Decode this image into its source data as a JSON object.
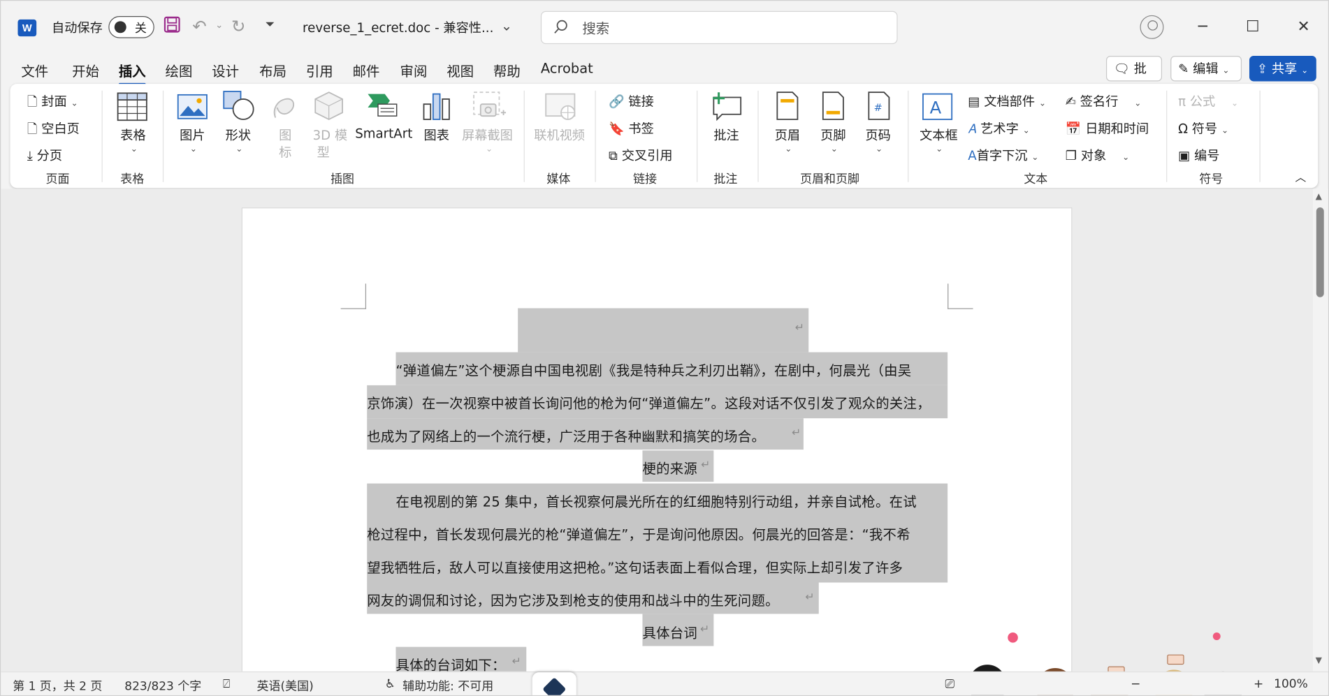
{
  "titlebar": {
    "autosave_label": "自动保存",
    "toggle_state": "关",
    "document_title": "reverse_1_ecret.doc  -  兼容性...",
    "search_placeholder": "搜索",
    "icons": [
      "word-logo",
      "save-icon",
      "undo-icon",
      "redo-icon",
      "customize-qat-icon",
      "search-icon",
      "avatar-icon",
      "minimize-icon",
      "maximize-icon",
      "close-icon"
    ]
  },
  "menu": {
    "tabs": [
      "文件",
      "开始",
      "插入",
      "绘图",
      "设计",
      "布局",
      "引用",
      "邮件",
      "审阅",
      "视图",
      "帮助",
      "Acrobat"
    ],
    "active_tab": "插入",
    "comment_button": "批注",
    "edit_button": "编辑",
    "share_button": "共享"
  },
  "ribbon": {
    "pages": {
      "items": [
        "封面",
        "空白页",
        "分页"
      ],
      "label": "页面"
    },
    "tables": {
      "item": "表格",
      "label": "表格"
    },
    "illustrations": {
      "picture": "图片",
      "shapes": "形状",
      "icons_line1": "图",
      "icons_line2": "标",
      "model_line1": "3D 模",
      "model_line2": "型",
      "smartart": "SmartArt",
      "chart": "图表",
      "screenshot": "屏幕截图",
      "label": "插图"
    },
    "media": {
      "item": "联机视频",
      "label": "媒体"
    },
    "links": {
      "items": [
        "链接",
        "书签",
        "交叉引用"
      ],
      "label": "链接"
    },
    "comments": {
      "item": "批注",
      "label": "批注"
    },
    "header_footer": {
      "items": [
        "页眉",
        "页脚",
        "页码"
      ],
      "label": "页眉和页脚"
    },
    "text": {
      "textbox": "文本框",
      "quick_parts": "文档部件",
      "wordart": "艺术字",
      "dropcap": "首字下沉",
      "signature": "签名行",
      "datetime": "日期和时间",
      "object": "对象",
      "label": "文本"
    },
    "symbols": {
      "equation": "公式",
      "symbol": "符号",
      "number": "编号",
      "label": "符号"
    }
  },
  "document": {
    "paragraph_mark": "↵",
    "lines": [
      "“弹道偏左”这个梗源自中国电视剧《我是特种兵之利刃出鞘》，在剧中，何晨光（由吴",
      "京饰演）在一次视察中被首长询问他的枪为何“弹道偏左”。这段对话不仅引发了观众的关注，",
      "也成为了网络上的一个流行梗，广泛用于各种幽默和搞笑的场合。",
      "梗的来源",
      "在电视剧的第 25 集中，首长视察何晨光所在的红细胞特别行动组，并亲自试枪。在试",
      "枪过程中，首长发现何晨光的枪“弹道偏左”，于是询问他原因。何晨光的回答是：“我不希",
      "望我牺牲后，敌人可以直接使用这把枪。”这句话表面上看似合理，但实际上却引发了许多",
      "网友的调侃和讨论，因为它涉及到枪支的使用和战斗中的生死问题。",
      "具体台词",
      "具体的台词如下："
    ],
    "spelling_flag_word": "梗"
  },
  "statusbar": {
    "page_info": "第 1 页，共 2 页",
    "word_count": "823/823 个字",
    "language": "英语(美国)",
    "accessibility": "辅助功能: 不可用",
    "zoom": "100%",
    "zoom_minus": "−",
    "zoom_plus": "+"
  },
  "colors": {
    "accent": "#185abd",
    "selection": "#c6c6c6",
    "window_bg": "#f3f3f3"
  }
}
